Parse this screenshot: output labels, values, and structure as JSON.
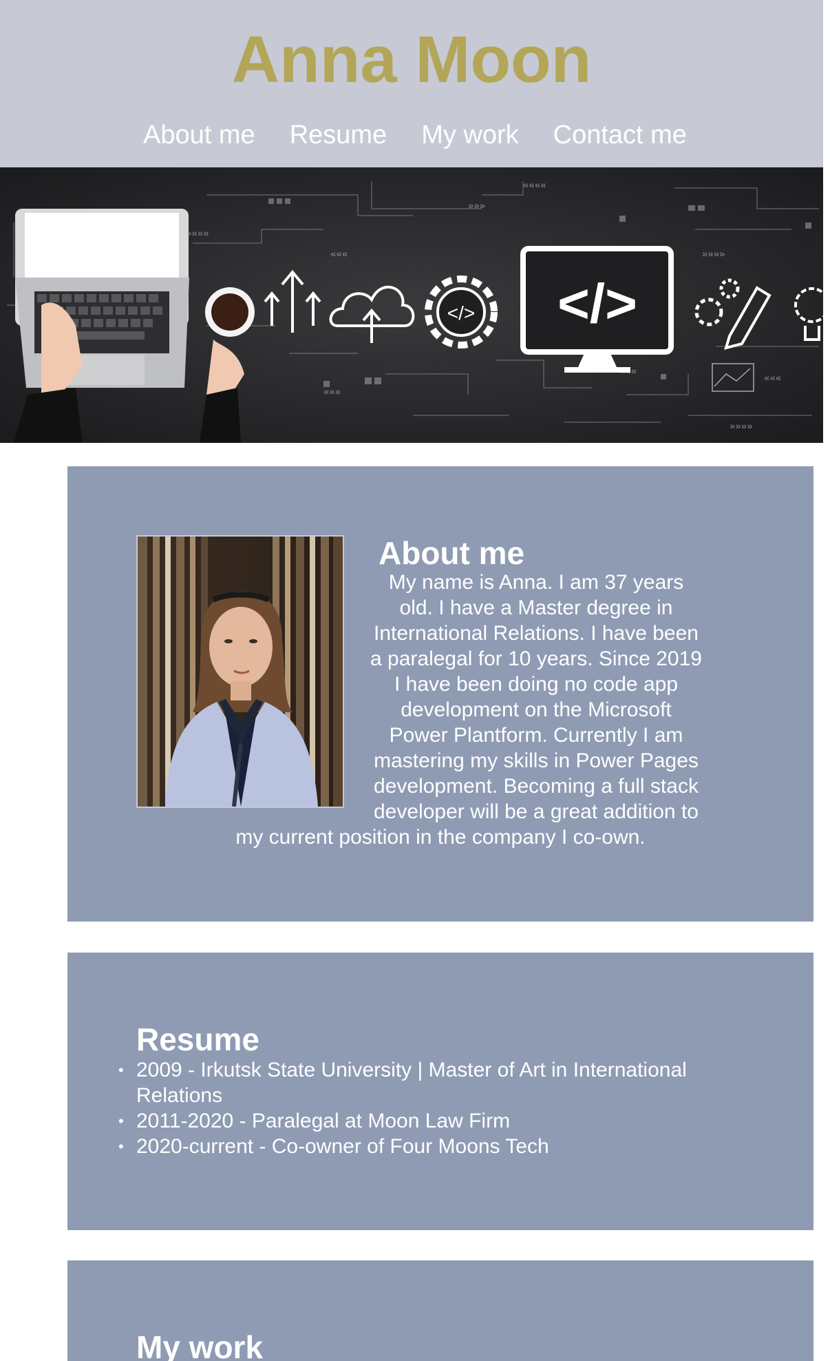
{
  "site": {
    "title": "Anna Moon",
    "nav": [
      "About me",
      "Resume",
      "My work",
      "Contact me"
    ]
  },
  "hero": {
    "description_icons": [
      "laptop-icon",
      "coffee-cup-icon",
      "upload-arrows-icon",
      "cloud-upload-icon",
      "gear-code-icon",
      "monitor-code-icon",
      "gears-icon",
      "pencil-icon",
      "lightbulb-icon"
    ],
    "code_symbol": "</>"
  },
  "about": {
    "heading": "About me",
    "body": "My name is Anna. I am 37 years old. I have a Master degree in International Relations. I have been a paralegal for 10 years. Since 2019 I have been doing no code app development on the Microsoft Power Plantform. Currently I am mastering my skills in Power Pages development. Becoming a full stack developer will be a great addition to my current position in the company I co-own."
  },
  "resume": {
    "heading": "Resume",
    "items": [
      "2009 - Irkutsk State University | Master of Art in International Relations",
      "2011-2020 - Paralegal at Moon Law Firm",
      "2020-current - Co-owner of Four Moons Tech"
    ]
  },
  "work": {
    "heading": "My work"
  },
  "colors": {
    "header_bg": "#c7c9d4",
    "title": "#b3a658",
    "card_bg": "#8e9bb3",
    "hero_bg": "#232325"
  }
}
